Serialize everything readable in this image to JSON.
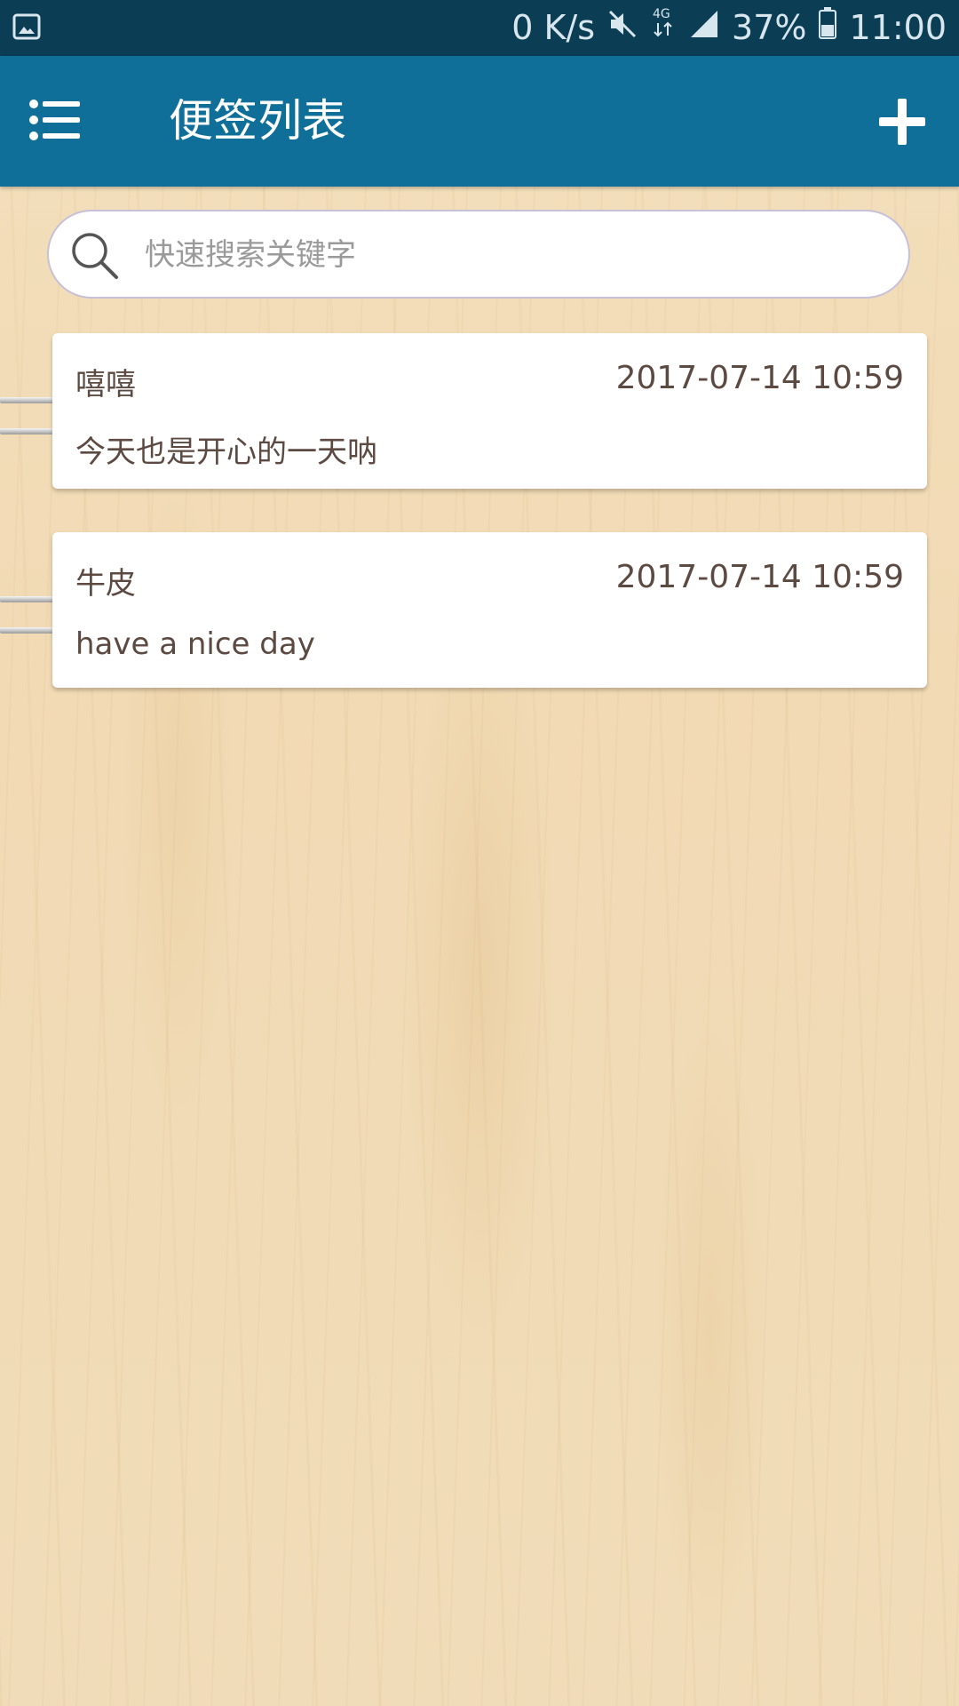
{
  "status_bar": {
    "net_speed": "0 K/s",
    "network_type": "4G",
    "battery": "37%",
    "time": "11:00",
    "icons": [
      "image-icon",
      "mute-icon",
      "network-4g-icon",
      "signal-icon",
      "battery-icon"
    ]
  },
  "app_bar": {
    "title": "便签列表",
    "menu_icon": "list-menu-icon",
    "add_icon": "plus-icon",
    "background": "#0f6f98"
  },
  "search": {
    "placeholder": "快速搜索关键字",
    "value": "",
    "icon": "search-icon"
  },
  "notes": [
    {
      "title": "嘻嘻",
      "time": "2017-07-14 10:59",
      "body": "今天也是开心的一天呐"
    },
    {
      "title": "牛皮",
      "time": "2017-07-14 10:59",
      "body": "have a nice day"
    }
  ],
  "colors": {
    "status_bar": "#0b3d55",
    "note_text": "#5c4a42",
    "background_wood": "#f1dab4"
  }
}
